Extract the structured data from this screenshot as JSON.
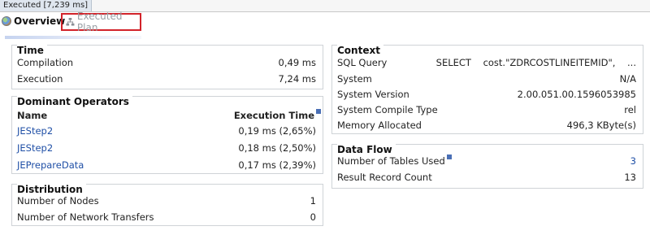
{
  "top": {
    "exec_tab": "Executed [7,239 ms]"
  },
  "tabs": {
    "overview": "Overview",
    "executed_plan": "Executed Plan"
  },
  "time": {
    "title": "Time",
    "rows": [
      {
        "label": "Compilation",
        "value": "0,49 ms"
      },
      {
        "label": "Execution",
        "value": "7,24 ms"
      }
    ]
  },
  "dominant": {
    "title": "Dominant Operators",
    "col_name": "Name",
    "col_time": "Execution Time",
    "rows": [
      {
        "name": "JEStep2",
        "time": "0,19 ms (2,65%)"
      },
      {
        "name": "JEStep2",
        "time": "0,18 ms (2,50%)"
      },
      {
        "name": "JEPrepareData",
        "time": "0,17 ms (2,39%)"
      }
    ]
  },
  "distribution": {
    "title": "Distribution",
    "rows": [
      {
        "label": "Number of Nodes",
        "value": "1"
      },
      {
        "label": "Number of Network Transfers",
        "value": "0"
      }
    ]
  },
  "context": {
    "title": "Context",
    "rows": [
      {
        "label": "SQL Query",
        "value": "SELECT    cost.\"ZDRCOSTLINEITEMID\",    ..."
      },
      {
        "label": "System",
        "value": "N/A"
      },
      {
        "label": "System Version",
        "value": "2.00.051.00.1596053985"
      },
      {
        "label": "System Compile Type",
        "value": "rel"
      },
      {
        "label": "Memory Allocated",
        "value": "496,3 KByte(s)"
      }
    ]
  },
  "dataflow": {
    "title": "Data Flow",
    "rows": [
      {
        "label": "Number of Tables Used",
        "value": "3"
      },
      {
        "label": "Result Record Count",
        "value": "13"
      }
    ]
  },
  "colors": {
    "link": "#1f4fa6",
    "highlight_border": "#d2232a"
  }
}
